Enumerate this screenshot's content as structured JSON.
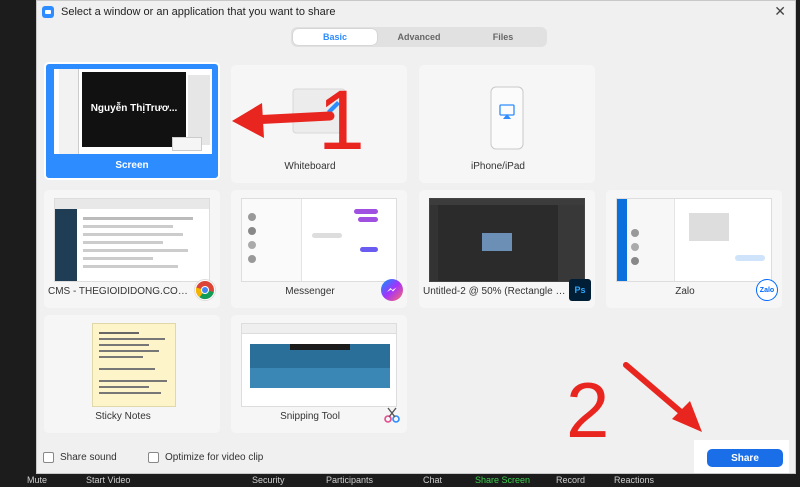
{
  "dialog": {
    "title": "Select a window or an application that you want to share",
    "close": "✕"
  },
  "tabs": [
    {
      "label": "Basic"
    },
    {
      "label": "Advanced"
    },
    {
      "label": "Files"
    }
  ],
  "tiles": [
    {
      "label": "Screen",
      "thumb_text": "Nguyễn ThịTrươ..."
    },
    {
      "label": "Whiteboard"
    },
    {
      "label": "iPhone/iPad"
    },
    {
      "label": "CMS - THEGIOIDIDONG.COM - G..."
    },
    {
      "label": "Messenger"
    },
    {
      "label": "Untitled-2 @ 50% (Rectangle 1, R..."
    },
    {
      "label": "Zalo",
      "badge": "Zalo"
    },
    {
      "label": "Sticky Notes"
    },
    {
      "label": "Snipping Tool"
    }
  ],
  "options": {
    "share_sound": "Share sound",
    "optimize_video": "Optimize for video clip"
  },
  "share_button": "Share",
  "toolbar": {
    "mute": "Mute",
    "start_video": "Start Video",
    "security": "Security",
    "participants": "Participants",
    "chat": "Chat",
    "share_screen": "Share Screen",
    "record": "Record",
    "reactions": "Reactions"
  },
  "annotations": {
    "step1": "1",
    "step2": "2"
  },
  "colors": {
    "accent": "#2d8cff",
    "share_button": "#1a6fe8",
    "annotation": "#e8261f",
    "share_screen_label": "#3ccf4e"
  }
}
